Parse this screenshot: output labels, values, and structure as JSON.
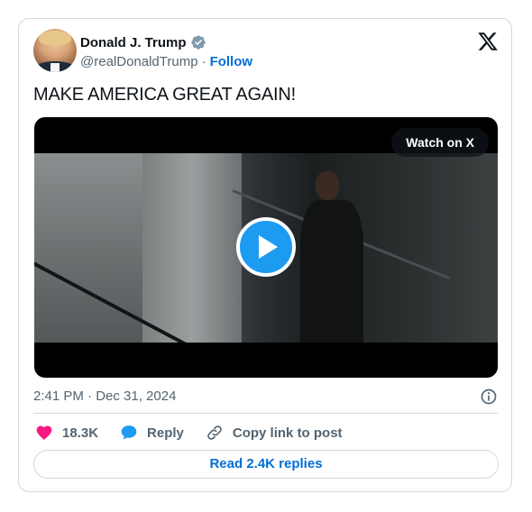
{
  "author": {
    "display_name": "Donald J. Trump",
    "handle": "@realDonaldTrump",
    "separator": "·",
    "follow_label": "Follow",
    "verified": true
  },
  "tweet": {
    "text": "MAKE AMERICA GREAT AGAIN!",
    "timestamp": "2:41 PM · Dec 31, 2024"
  },
  "media": {
    "type": "video",
    "watch_label": "Watch on X"
  },
  "actions": {
    "likes": "18.3K",
    "reply_label": "Reply",
    "copy_label": "Copy link to post"
  },
  "footer": {
    "read_replies_label": "Read 2.4K replies"
  },
  "colors": {
    "accent": "#006fd6",
    "play_button": "#1d9bf0",
    "like_heart": "#f91880",
    "secondary_text": "#536471",
    "border": "#cfd9de"
  },
  "icons": [
    "verified-badge-icon",
    "x-logo-icon",
    "play-icon",
    "info-icon",
    "heart-icon",
    "reply-bubble-icon",
    "link-icon"
  ]
}
